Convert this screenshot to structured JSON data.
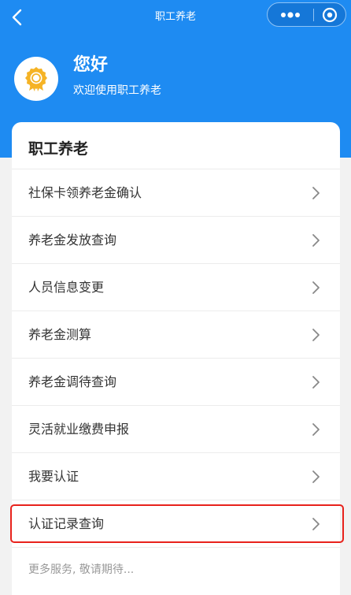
{
  "navbar": {
    "title": "职工养老",
    "back_icon": "chevron-left-icon",
    "more_icon": "more-dots-icon",
    "target_icon": "target-circle-icon"
  },
  "greeting": {
    "icon": "award-badge-icon",
    "title": "您好",
    "subtitle": "欢迎使用职工养老"
  },
  "section": {
    "title": "职工养老",
    "items": [
      {
        "label": "社保卡领养老金确认"
      },
      {
        "label": "养老金发放查询"
      },
      {
        "label": "人员信息变更"
      },
      {
        "label": "养老金测算"
      },
      {
        "label": "养老金调待查询"
      },
      {
        "label": "灵活就业缴费申报"
      },
      {
        "label": "我要认证"
      },
      {
        "label": "认证记录查询"
      }
    ],
    "highlighted_index": 7,
    "footer": "更多服务, 敬请期待..."
  },
  "colors": {
    "primary": "#1e8bf2",
    "highlight": "#e8221c",
    "badge": "#f5b325"
  }
}
